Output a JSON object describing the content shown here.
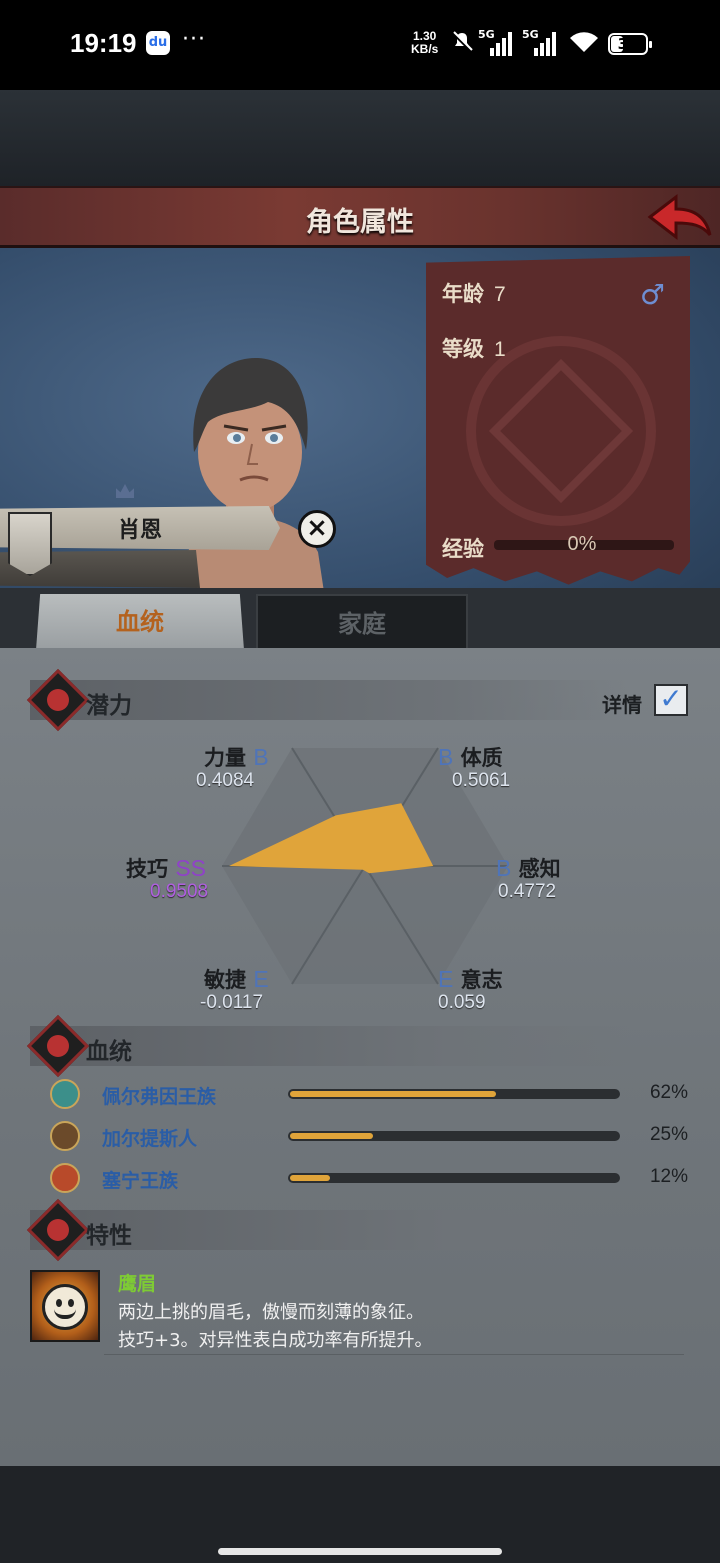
{
  "status_bar": {
    "time": "19:19",
    "app_icon": "baidu-icon",
    "dots": "···",
    "speed_top": "1.30",
    "speed_bottom": "KB/s",
    "signal1": "5G",
    "signal2": "5G",
    "battery": "30"
  },
  "header": {
    "title": "角色属性",
    "back_icon": "back-arrow-icon"
  },
  "character": {
    "name": "肖恩",
    "age_label": "年龄",
    "age": "7",
    "gender_icon": "♂",
    "level_label": "等级",
    "level": "1",
    "exp_label": "经验",
    "exp_value": "0%",
    "exp_progress": 0
  },
  "tabs": [
    {
      "label": "血统",
      "active": true
    },
    {
      "label": "家庭",
      "active": false
    }
  ],
  "potential": {
    "title": "潜力",
    "detail_label": "详情",
    "detail_checked": true,
    "stats": [
      {
        "name": "力量",
        "grade": "B",
        "value": "0.4084"
      },
      {
        "name": "体质",
        "grade": "B",
        "value": "0.5061"
      },
      {
        "name": "感知",
        "grade": "B",
        "value": "0.4772"
      },
      {
        "name": "意志",
        "grade": "E",
        "value": "0.059"
      },
      {
        "name": "敏捷",
        "grade": "E",
        "value": "-0.0117"
      },
      {
        "name": "技巧",
        "grade": "SS",
        "value": "0.9508"
      }
    ],
    "radar_color": "#e0a43a"
  },
  "bloodline": {
    "title": "血统",
    "items": [
      {
        "name": "佩尔弗因王族",
        "percent": "62%",
        "ratio": 0.62,
        "color": "#3c8f8a"
      },
      {
        "name": "加尔提斯人",
        "percent": "25%",
        "ratio": 0.25,
        "color": "#6b4a2a"
      },
      {
        "name": "塞宁王族",
        "percent": "12%",
        "ratio": 0.12,
        "color": "#b84a2a"
      }
    ]
  },
  "traits": {
    "title": "特性",
    "items": [
      {
        "name": "鹰眉",
        "desc1": "两边上挑的眉毛，傲慢而刻薄的象征。",
        "desc2": "技巧+3。对异性表白成功率有所提升。"
      }
    ]
  }
}
